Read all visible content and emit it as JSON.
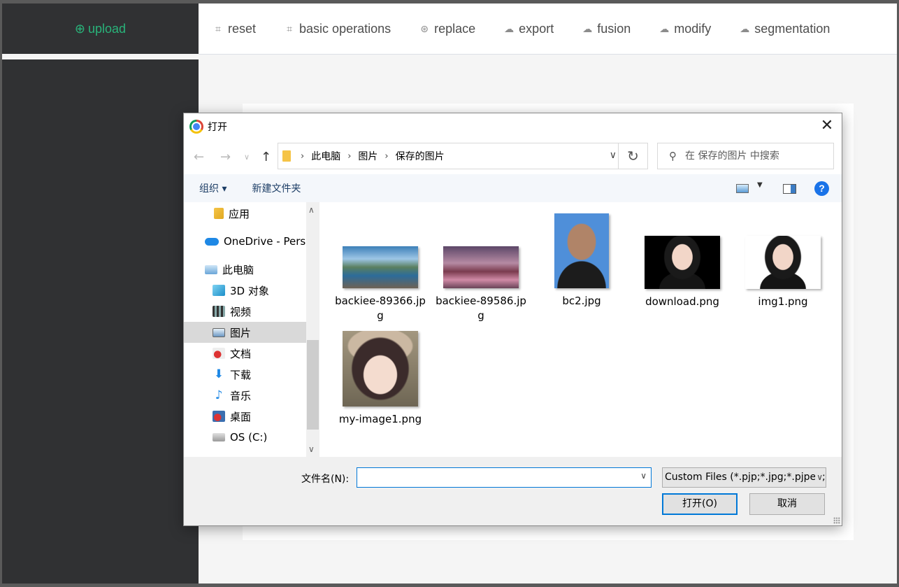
{
  "app": {
    "upload_label": "upload",
    "nav": [
      {
        "label": "reset",
        "icon": "crop-icon"
      },
      {
        "label": "basic operations",
        "icon": "crop-icon"
      },
      {
        "label": "replace",
        "icon": "aperture-icon"
      },
      {
        "label": "export",
        "icon": "cloud-download-icon"
      },
      {
        "label": "fusion",
        "icon": "cloud-download-icon"
      },
      {
        "label": "modify",
        "icon": "cloud-download-icon"
      },
      {
        "label": "segmentation",
        "icon": "cloud-download-icon"
      }
    ],
    "accent_color": "#29b37a"
  },
  "dialog": {
    "title": "打开",
    "breadcrumb": [
      "此电脑",
      "图片",
      "保存的图片"
    ],
    "search_placeholder": "在 保存的图片 中搜索",
    "toolbar": {
      "organize": "组织 ▾",
      "new_folder": "新建文件夹",
      "help": "?"
    },
    "tree": [
      {
        "label": "应用",
        "icon": "apps-folder-icon"
      },
      {
        "label": "OneDrive - Perso",
        "icon": "onedrive-cloud-icon"
      },
      {
        "label": "此电脑",
        "icon": "this-pc-icon"
      },
      {
        "label": "3D 对象",
        "icon": "3d-objects-icon"
      },
      {
        "label": "视频",
        "icon": "video-icon"
      },
      {
        "label": "图片",
        "icon": "pictures-icon",
        "selected": true
      },
      {
        "label": "文档",
        "icon": "documents-icon"
      },
      {
        "label": "下载",
        "icon": "download-arrow-icon"
      },
      {
        "label": "音乐",
        "icon": "music-note-icon"
      },
      {
        "label": "桌面",
        "icon": "desktop-icon"
      },
      {
        "label": "OS (C:)",
        "icon": "drive-icon"
      }
    ],
    "files": [
      {
        "name": "backiee-89366.jpg",
        "thumb": "mountain-lake-landscape"
      },
      {
        "name": "backiee-89586.jpg",
        "thumb": "pagoda-mount-fuji"
      },
      {
        "name": "bc2.jpg",
        "thumb": "man-portrait-blue-background"
      },
      {
        "name": "download.png",
        "thumb": "woman-portrait-black-background"
      },
      {
        "name": "img1.png",
        "thumb": "woman-portrait-white-background"
      },
      {
        "name": "my-image1.png",
        "thumb": "anime-girl-illustration"
      }
    ],
    "filename_label": "文件名(N):",
    "filename_value": "",
    "filetype": "Custom Files (*.pjp;*.jpg;*.pjpeg;*.jpeg)",
    "open_button": "打开(O)",
    "cancel_button": "取消"
  }
}
